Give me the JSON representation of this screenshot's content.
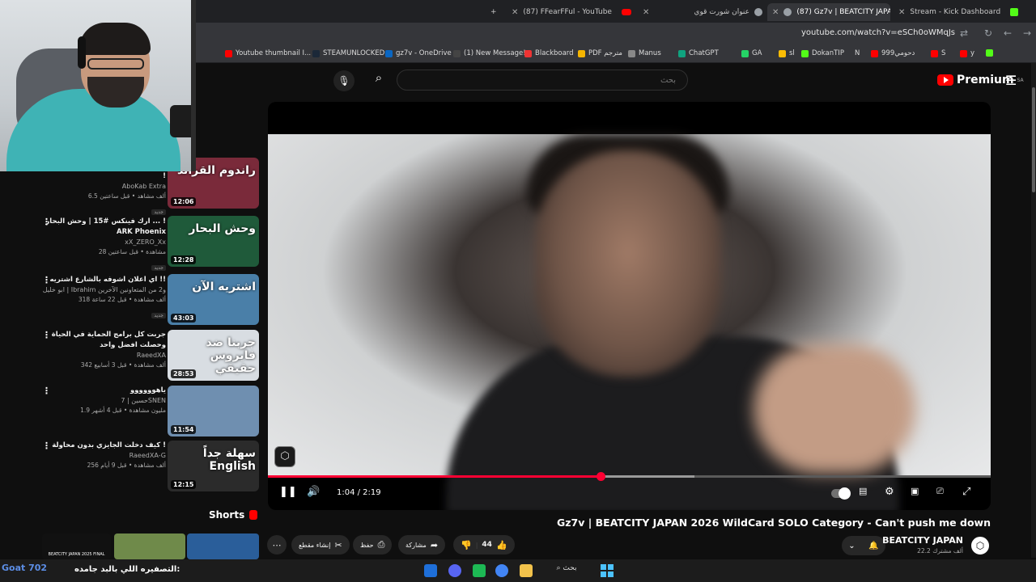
{
  "browser": {
    "tabs": [
      {
        "label": "(87) FFearFFul - YouTube",
        "active": false
      },
      {
        "label": "عنوان شورت قوي",
        "active": false
      },
      {
        "label": "(87) Gz7v | BEATCITY JAPAN",
        "active": true
      },
      {
        "label": "Stream - Kick Dashboard",
        "active": false
      }
    ],
    "url": "youtube.com/watch?v=eSCh0oWMqJs",
    "bookmarks": [
      "Youtube thumbnail I...",
      "STEAMUNLOCKED",
      "gz7v - OneDrive",
      "(1) New Message!",
      "Blackboard",
      "PDF مترجم",
      "Manus",
      "ChatGPT",
      "GA",
      "sl",
      "DokanTIP",
      "N",
      "دحومي999",
      "S",
      "y"
    ]
  },
  "youtube": {
    "search_placeholder": "بحث",
    "logo_text": "Premium",
    "logo_region": "SA"
  },
  "sidebar": {
    "items": [
      {
        "title": "!",
        "channel": "AboKab Extra",
        "meta": "6.5 ألف مشاهد • قبل ساعتين",
        "badge": "جديد",
        "duration": "12:06",
        "thumb_text": "راندوم القراند",
        "thumb_color": "#7a2a3a"
      },
      {
        "title": "ارك فينكس #15 | وحش البحار ... ! ARK Phoenix",
        "channel": "xX_ZERO_Xx",
        "meta": "28 مشاهدة • قبل ساعتين",
        "badge": "جديد",
        "duration": "12:28",
        "thumb_text": "وحش البحار",
        "thumb_color": "#1f5a3a"
      },
      {
        "title": "اي اعلان اشوفه بالشارع اشتريه !!",
        "channel": "ابو خليل | Ibrahim و2 من المتعاونين الآخرين",
        "meta": "318 ألف مشاهدة • قبل 22 ساعة",
        "badge": "جديد",
        "duration": "43:03",
        "thumb_text": "اشتريه الآن",
        "thumb_color": "#4a7fa8"
      },
      {
        "title": "جربت كل برامج الحماية في الحياة وحصلت افضل واحد",
        "channel": "RaeedXA",
        "meta": "342 ألف مشاهدة • قبل 3 أسابيع",
        "badge": "",
        "duration": "28:53",
        "thumb_text": "جربنا ضد فايروس حقيقي",
        "thumb_color": "#d8dde2"
      },
      {
        "title": "ياهوووووو",
        "channel": "حسين | 7SNEN",
        "meta": "1.9 مليون مشاهدة • قبل 4 أشهر",
        "badge": "",
        "duration": "11:54",
        "thumb_text": "",
        "thumb_color": "#6f8fb0"
      },
      {
        "title": "كيف دخلت الجايزي بدون محاولة !",
        "channel": "RaeedXA-G",
        "meta": "256 ألف مشاهدة • قبل 9 أيام",
        "badge": "",
        "duration": "12:15",
        "thumb_text": "سهلة جداً English",
        "thumb_color": "#2b2b2b"
      }
    ],
    "shorts_label": "Shorts",
    "shorts_first_caption": "BEATCITY JAPAN 2025 FINAL"
  },
  "player": {
    "current_time": "1:04",
    "duration": "2:19",
    "time_text": "1:04 / 2:19",
    "progress_fraction": 0.46,
    "buffered_fraction": 0.59
  },
  "video": {
    "title": "Gz7v | BEATCITY JAPAN 2026 WildCard SOLO Category - Can't push me down",
    "channel": "BEATCITY JAPAN",
    "subscribers": "22.2 ألف مشترك",
    "likes": "44",
    "share_label": "مشاركة",
    "save_label": "حفظ",
    "clip_label": "إنشاء مقطع"
  },
  "taskbar": {
    "ticker": "التصفيره اللي بالبد جامده:",
    "overlay": "Goat",
    "overlay_number": "702",
    "search_label": "بحث"
  },
  "colors": {
    "accent_red": "#ff0033",
    "kick_green": "#53fc18",
    "page_bg": "#0f0f0f"
  }
}
